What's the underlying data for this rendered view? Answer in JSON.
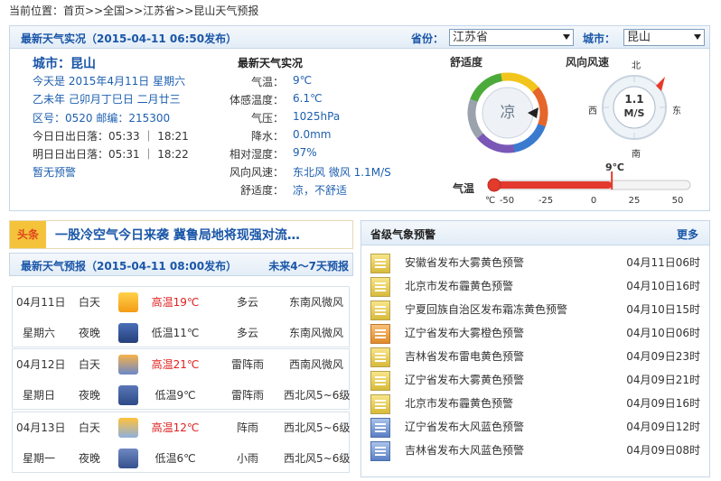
{
  "breadcrumb": {
    "prefix": "当前位置：",
    "home": "首页",
    "sep1": ">>",
    "country": "全国",
    "sep2": ">>",
    "province": "江苏省",
    "sep3": ">>",
    "current": "昆山天气预报"
  },
  "current": {
    "title": "最新天气实况（2015-04-11 06:50发布）",
    "province_label": "省份：",
    "province_value": "江苏省",
    "city_label": "城市：",
    "city_value": "昆山",
    "city_name": "城市：昆山",
    "today_line": "今天是 2015年4月11日 星期六",
    "lunar_line": "乙未年 己卯月丁巳日 二月廿三",
    "codes_line": "区号：0520  邮编：215300",
    "sun_today": "今日日出日落：05:33 ｜ 18:21",
    "sun_tomorrow": "明日日出日落：05:31 ｜ 18:22",
    "warning_none": "暂无预警",
    "obs_title": "最新天气实况",
    "obs": [
      {
        "label": "气温：",
        "value": "9℃"
      },
      {
        "label": "体感温度：",
        "value": "6.1℃"
      },
      {
        "label": "气压：",
        "value": "1025hPa"
      },
      {
        "label": "降水：",
        "value": "0.0mm"
      },
      {
        "label": "相对湿度：",
        "value": "97%"
      },
      {
        "label": "风向风速：",
        "value": "东北风 微风 1.1M/S"
      },
      {
        "label": "舒适度：",
        "value": "凉，不舒适"
      }
    ],
    "comfort_title": "舒适度",
    "comfort_value": "凉",
    "wind_title": "风向风速",
    "wind_speed": "1.1",
    "wind_unit": "M/S",
    "compass": {
      "n": "北",
      "s": "南",
      "e": "东",
      "w": "西"
    },
    "wind_direction_deg": 45,
    "temp_title": "气温",
    "temp_value": "9℃",
    "temp_reading": 9,
    "temp_scale": {
      "unit": "℃",
      "ticks": [
        "-50",
        "-25",
        "0",
        "25",
        "50"
      ],
      "min": -50,
      "max": 50
    }
  },
  "headline": {
    "badge": "头条",
    "text": "一股冷空气今日来袭  冀鲁局地将现强对流…"
  },
  "forecast": {
    "title": "最新天气预报（2015-04-11  08:00发布）",
    "more": "未来4～7天预报",
    "days": [
      {
        "date": "04月11日",
        "weekday": "星期六",
        "day": {
          "period": "白天",
          "temp": "高温19℃",
          "weather": "多云",
          "wind": "东南风微风",
          "icon": "partly-cloudy-day-icon"
        },
        "night": {
          "period": "夜晚",
          "temp": "低温11℃",
          "weather": "多云",
          "wind": "东南风微风",
          "icon": "moon-cloud-icon"
        }
      },
      {
        "date": "04月12日",
        "weekday": "星期日",
        "day": {
          "period": "白天",
          "temp": "高温21℃",
          "weather": "雷阵雨",
          "wind": "西南风微风",
          "icon": "thunderstorm-icon"
        },
        "night": {
          "period": "夜晚",
          "temp": "低温9℃",
          "weather": "雷阵雨",
          "wind": "西北风5~6级",
          "icon": "thunderstorm-icon"
        }
      },
      {
        "date": "04月13日",
        "weekday": "星期一",
        "day": {
          "period": "白天",
          "temp": "高温12℃",
          "weather": "阵雨",
          "wind": "西北风5~6级",
          "icon": "shower-icon"
        },
        "night": {
          "period": "夜晚",
          "temp": "低温6℃",
          "weather": "小雨",
          "wind": "西北风5~6级",
          "icon": "light-rain-icon"
        }
      }
    ]
  },
  "alerts": {
    "title": "省级气象预警",
    "more": "更多",
    "items": [
      {
        "text": "安徽省发布大雾黄色预警",
        "time": "04月11日06时",
        "color": "yellow"
      },
      {
        "text": "北京市发布霾黄色预警",
        "time": "04月10日16时",
        "color": "yellow"
      },
      {
        "text": "宁夏回族自治区发布霜冻黄色预警",
        "time": "04月10日15时",
        "color": "yellow"
      },
      {
        "text": "辽宁省发布大雾橙色预警",
        "time": "04月10日06时",
        "color": "orange"
      },
      {
        "text": "吉林省发布雷电黄色预警",
        "time": "04月09日23时",
        "color": "yellow"
      },
      {
        "text": "辽宁省发布大雾黄色预警",
        "time": "04月09日21时",
        "color": "yellow"
      },
      {
        "text": "北京市发布霾黄色预警",
        "time": "04月09日16时",
        "color": "yellow"
      },
      {
        "text": "辽宁省发布大风蓝色预警",
        "time": "04月09日12时",
        "color": "blue"
      },
      {
        "text": "吉林省发布大风蓝色预警",
        "time": "04月09日08时",
        "color": "blue"
      }
    ]
  },
  "colors": {
    "title_blue": "#1a56a8",
    "value_blue": "#1d5fb0",
    "hot_red": "#e02020",
    "headline_orange": "#f2a21d",
    "panel_border": "#c6d6e8"
  }
}
